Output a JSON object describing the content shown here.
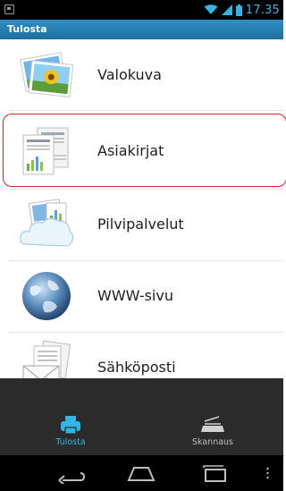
{
  "status_bar": {
    "time": "17.35",
    "icons": [
      "notification-icon",
      "wifi-icon",
      "signal-icon",
      "battery-icon"
    ],
    "accent_color": "#33b5e5"
  },
  "app_bar": {
    "title": "Tulosta"
  },
  "menu": {
    "items": [
      {
        "label": "Valokuva",
        "icon": "photo-icon"
      },
      {
        "label": "Asiakirjat",
        "icon": "document-icon",
        "highlighted": true
      },
      {
        "label": "Pilvipalvelut",
        "icon": "cloud-icon"
      },
      {
        "label": "WWW-sivu",
        "icon": "globe-icon"
      },
      {
        "label": "Sähköposti",
        "icon": "email-icon"
      }
    ],
    "highlight_color": "#d6232f"
  },
  "tabs": [
    {
      "label": "Tulosta",
      "icon": "printer-icon",
      "active": true
    },
    {
      "label": "Skannaus",
      "icon": "scanner-icon",
      "active": false
    }
  ],
  "nav_bar": {
    "buttons": [
      "back-icon",
      "home-icon",
      "recent-apps-icon",
      "overflow-menu-icon"
    ]
  }
}
